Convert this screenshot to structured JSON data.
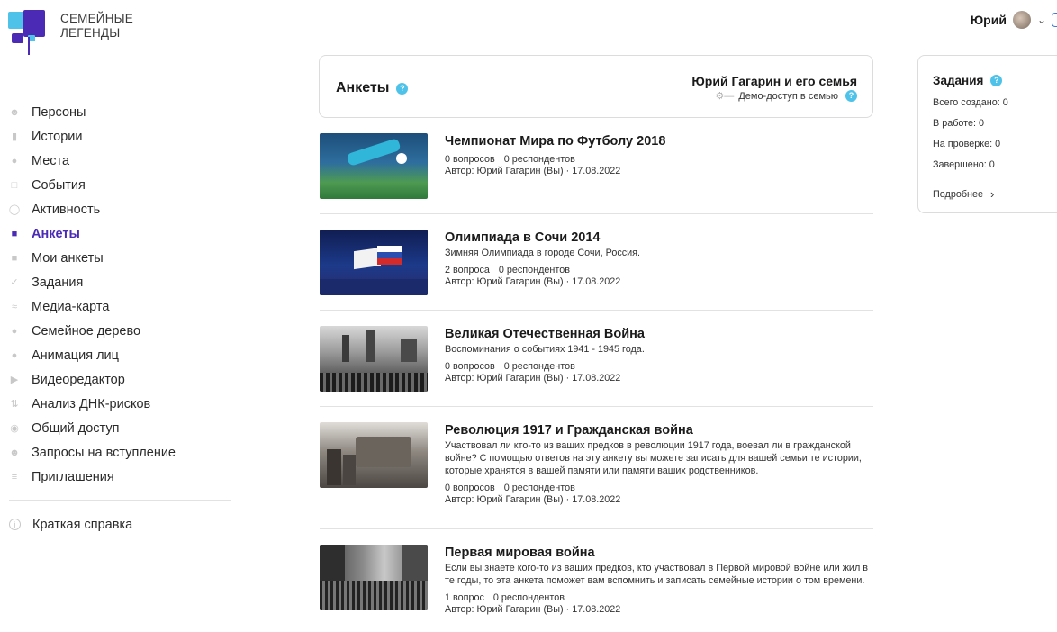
{
  "logo": {
    "line1": "СЕМЕЙНЫЕ",
    "line2": "ЛЕГЕНДЫ"
  },
  "user": {
    "name": "Юрий"
  },
  "sidebar": {
    "items": [
      {
        "label": "Персоны",
        "icon": "persons-icon",
        "active": false
      },
      {
        "label": "Истории",
        "icon": "stories-icon",
        "active": false
      },
      {
        "label": "Места",
        "icon": "place-pin-icon",
        "active": false
      },
      {
        "label": "События",
        "icon": "calendar-icon",
        "active": false
      },
      {
        "label": "Активность",
        "icon": "clock-icon",
        "active": false
      },
      {
        "label": "Анкеты",
        "icon": "clipboard-icon",
        "active": true
      },
      {
        "label": "Мои анкеты",
        "icon": "clipboard-icon",
        "active": false
      },
      {
        "label": "Задания",
        "icon": "check-circle-icon",
        "active": false
      },
      {
        "label": "Медиа-карта",
        "icon": "media-map-icon",
        "active": false
      },
      {
        "label": "Семейное дерево",
        "icon": "tree-icon",
        "active": false
      },
      {
        "label": "Анимация лиц",
        "icon": "face-icon",
        "active": false
      },
      {
        "label": "Видеоредактор",
        "icon": "play-icon",
        "active": false
      },
      {
        "label": "Анализ ДНК-рисков",
        "icon": "dna-icon",
        "active": false
      },
      {
        "label": "Общий доступ",
        "icon": "eye-icon",
        "active": false
      },
      {
        "label": "Запросы на вступление",
        "icon": "user-plus-icon",
        "active": false
      },
      {
        "label": "Приглашения",
        "icon": "invite-icon",
        "active": false
      }
    ],
    "help_label": "Краткая справка"
  },
  "header": {
    "title": "Анкеты",
    "family": "Юрий Гагарин и его семья",
    "demo": "Демо-доступ в семью"
  },
  "surveys": [
    {
      "title": "Чемпионат Мира по Футболу 2018",
      "desc": "",
      "questions": "0 вопросов",
      "respondents": "0 респондентов",
      "author": "Автор: Юрий Гагарин (Вы) · 17.08.2022",
      "thumb": "football-goalkeeper-photo"
    },
    {
      "title": "Олимпиада в Сочи 2014",
      "desc": "Зимняя Олимпиада в городе Сочи, Россия.",
      "questions": "2 вопроса",
      "respondents": "0 респондентов",
      "author": "Автор: Юрий Гагарин (Вы) · 17.08.2022",
      "thumb": "olympic-flags-photo"
    },
    {
      "title": "Великая Отечественная Война",
      "desc": "Воспоминания о событиях 1941 - 1945 года.",
      "questions": "0 вопросов",
      "respondents": "0 респондентов",
      "author": "Автор: Юрий Гагарин (Вы) · 17.08.2022",
      "thumb": "red-square-parade-photo"
    },
    {
      "title": "Революция 1917 и Гражданская война",
      "desc": "Участвовал ли кто-то из ваших предков в революции 1917 года, воевал ли в гражданской войне? С помощью ответов на эту анкету вы можете записать для вашей семьи те истории, которые хранятся в вашей памяти или памяти ваших родственников.",
      "questions": "0 вопросов",
      "respondents": "0 респондентов",
      "author": "Автор: Юрий Гагарин (Вы) · 17.08.2022",
      "thumb": "armored-car-photo"
    },
    {
      "title": "Первая мировая война",
      "desc": "Если вы знаете кого-то из ваших предков, кто участвовал в Первой мировой войне или жил в те годы, то эта анкета поможет вам вспомнить и записать семейные истории о том времени.",
      "questions": "1 вопрос",
      "respondents": "0 респондентов",
      "author": "Автор: Юрий Гагарин (Вы) · 17.08.2022",
      "thumb": "street-crowd-photo"
    }
  ],
  "tasks": {
    "title": "Задания",
    "created": "Всего создано: 0",
    "in_progress": "В работе: 0",
    "review": "На проверке: 0",
    "done": "Завершено: 0",
    "more": "Подробнее"
  },
  "colors": {
    "accent": "#4b2bb5",
    "info": "#4ec2e8"
  }
}
